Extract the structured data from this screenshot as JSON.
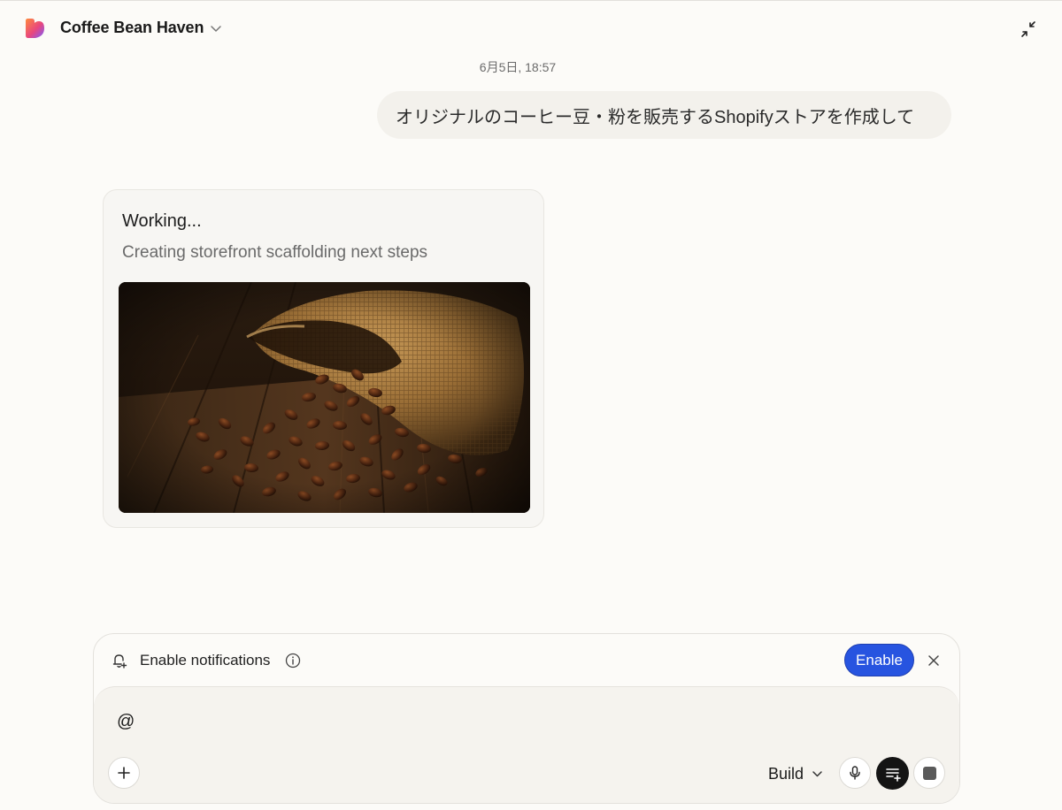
{
  "header": {
    "project_name": "Coffee Bean Haven",
    "brand_colors": [
      "#ff8a3d",
      "#e8477e",
      "#7b5cff"
    ]
  },
  "chat": {
    "timestamp": "6月5日, 18:57",
    "user_message": "オリジナルのコーヒー豆・粉を販売するShopifyストアを作成して",
    "status_card": {
      "title": "Working...",
      "subtitle": "Creating storefront scaffolding next steps",
      "image_subject": "burlap sack of spilled coffee beans on wooden table"
    }
  },
  "composer": {
    "notification": {
      "label": "Enable notifications",
      "button_label": "Enable"
    },
    "input_value": "@",
    "mode_label": "Build",
    "accent_color": "#2754e0"
  }
}
